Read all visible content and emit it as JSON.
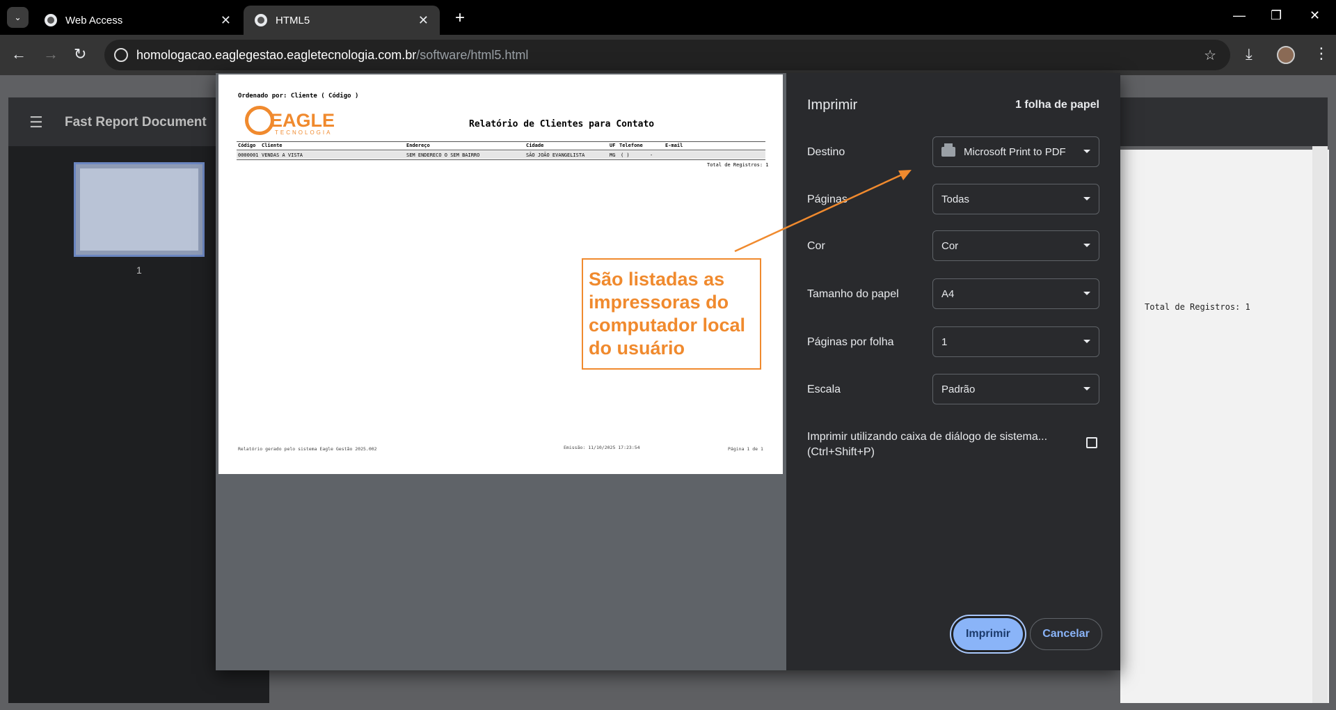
{
  "browser": {
    "tabs": [
      {
        "title": "Web Access"
      },
      {
        "title": "HTML5"
      }
    ],
    "url_host": "homologacao.eaglegestao.eagletecnologia.com.br",
    "url_path": "/software/html5.html"
  },
  "app": {
    "title": "Fast Report Document",
    "thumbnail_page": "1",
    "total_text": "Total de Registros: 1"
  },
  "print_dialog": {
    "title": "Imprimir",
    "sheets": "1 folha de papel",
    "rows": [
      {
        "label": "Destino",
        "value": "Microsoft Print to PDF"
      },
      {
        "label": "Páginas",
        "value": "Todas"
      },
      {
        "label": "Cor",
        "value": "Cor"
      },
      {
        "label": "Tamanho do papel",
        "value": "A4"
      },
      {
        "label": "Páginas por folha",
        "value": "1"
      },
      {
        "label": "Escala",
        "value": "Padrão"
      }
    ],
    "system_dialog": "Imprimir utilizando caixa de diálogo de sistema... (Ctrl+Shift+P)",
    "print_button": "Imprimir",
    "cancel_button": "Cancelar"
  },
  "report": {
    "ordered_by": "Ordenado por: Cliente ( Código )",
    "logo": "EAGLE",
    "logo_sub": "TECNOLOGIA",
    "title": "Relatório de Clientes para Contato",
    "headers": [
      "Código",
      "Cliente",
      "Endereço",
      "Cidade",
      "UF",
      "Telefone",
      "E-mail"
    ],
    "row": [
      "0000001",
      "VENDAS A VISTA",
      "SEM ENDERECO O SEM BAIRRO",
      "SÃO JOÃO EVANGELISTA",
      "MG",
      "(  )",
      "-"
    ],
    "total": "Total de Registros: 1",
    "footer_left": "Relatório gerado pelo sistema Eagle Gestão 2025.002",
    "footer_mid": "Emissão: 11/10/2025  17:23:54",
    "footer_right": "Página 1 de 1"
  },
  "annotation": {
    "text": "São listadas as impressoras do computador local do usuário",
    "color": "#f08a2e"
  }
}
